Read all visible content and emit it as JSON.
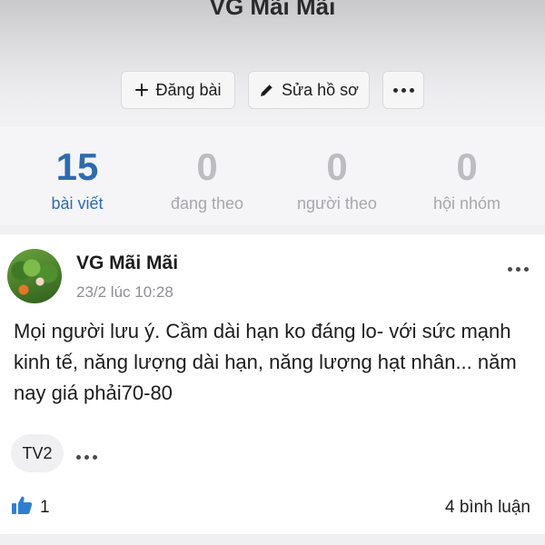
{
  "profile": {
    "name": "VG Mãi Mãi"
  },
  "actions": {
    "post_label": "Đăng bài",
    "edit_label": "Sửa hồ sơ"
  },
  "stats": [
    {
      "value": "15",
      "label": "bài viết",
      "active": true
    },
    {
      "value": "0",
      "label": "đang theo",
      "active": false
    },
    {
      "value": "0",
      "label": "người theo",
      "active": false
    },
    {
      "value": "0",
      "label": "hội nhóm",
      "active": false
    }
  ],
  "post": {
    "author": "VG Mãi Mãi",
    "time": "23/2 lúc 10:28",
    "content": "Mọi người lưu ý. Cầm dài hạn ko đáng lo- với sức mạnh kinh tế, năng lượng dài hạn, năng lượng hạt nhân... năm nay giá phải70-80",
    "tag": "TV2",
    "likes": "1",
    "comments": "4 bình luận"
  },
  "colors": {
    "accent": "#2d6bb0",
    "like_icon": "#2d7fd3",
    "muted": "#bdbdc1"
  },
  "icons": {
    "add": "plus-icon",
    "edit": "pencil-icon",
    "more": "more-dots-icon",
    "like": "thumbs-up-icon"
  }
}
